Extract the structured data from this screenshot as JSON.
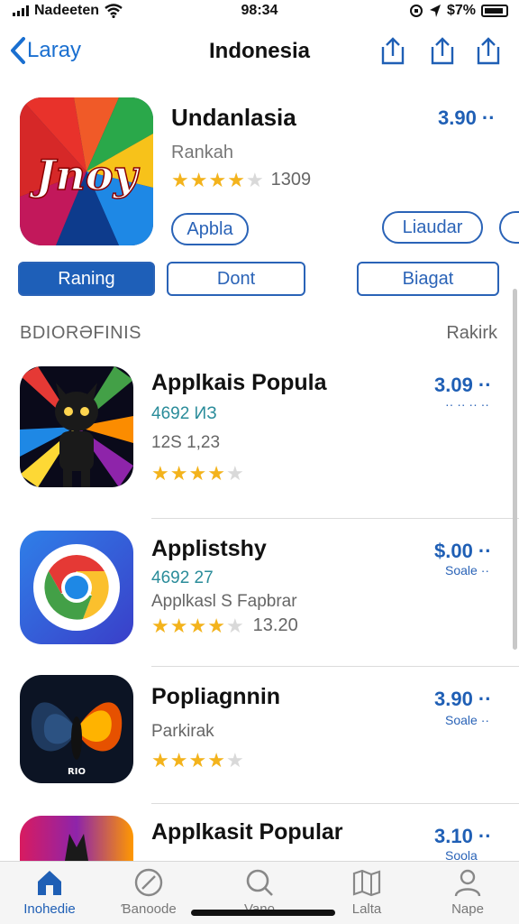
{
  "status_bar": {
    "carrier": "Nadeeten",
    "time": "98:34",
    "battery_text": "$7%"
  },
  "nav": {
    "back_label": "Laray",
    "title": "Indonesia"
  },
  "featured": {
    "title": "Undanlasia",
    "subtitle": "Rankah",
    "rating_count": "1309",
    "price": "3.90 ··",
    "icon_text": "Jnoy",
    "stars": 4,
    "open_button": "Apbla",
    "action_button": "Liaudar"
  },
  "segments": [
    {
      "label": "Raning",
      "active": true
    },
    {
      "label": "Dont",
      "active": false
    },
    {
      "label": "Biagat",
      "active": false
    }
  ],
  "section": {
    "title": "BDIORƏFINIS",
    "action": "Rakirk"
  },
  "apps": [
    {
      "title": "Applkais Popula",
      "line2": "4692 ИЗ",
      "line3": "12S  1,23",
      "price": "3.09 ··",
      "price_sub": "··  ·· ·· ··",
      "stars": 4,
      "rating_count": ""
    },
    {
      "title": "Applistshy",
      "line2": "4692 27",
      "line3": "Applkasl S Fapbrar",
      "price": "$.00 ··",
      "price_sub": "Soale ··",
      "stars": 3.5,
      "rating_count": "13.20"
    },
    {
      "title": "Popliagnnin",
      "line2": "Parkirak",
      "line3": "",
      "price": "3.90 ··",
      "price_sub": "Soale ··",
      "stars": 4,
      "rating_count": ""
    },
    {
      "title": "Applkasit Popular",
      "line2": "",
      "line3": "",
      "price": "3.10 ··",
      "price_sub": "Soola",
      "stars": 0,
      "rating_count": ""
    }
  ],
  "tabs": [
    {
      "label": "Inohedie",
      "icon": "home-icon",
      "active": true
    },
    {
      "label": "Ɓanoode",
      "icon": "compass-icon",
      "active": false
    },
    {
      "label": "Vano",
      "icon": "search-icon",
      "active": false
    },
    {
      "label": "Lalta",
      "icon": "map-icon",
      "active": false
    },
    {
      "label": "Nape",
      "icon": "person-icon",
      "active": false
    }
  ],
  "colors": {
    "accent": "#1f5fb5",
    "star": "#f3b31c",
    "teal": "#2a8c9a"
  }
}
